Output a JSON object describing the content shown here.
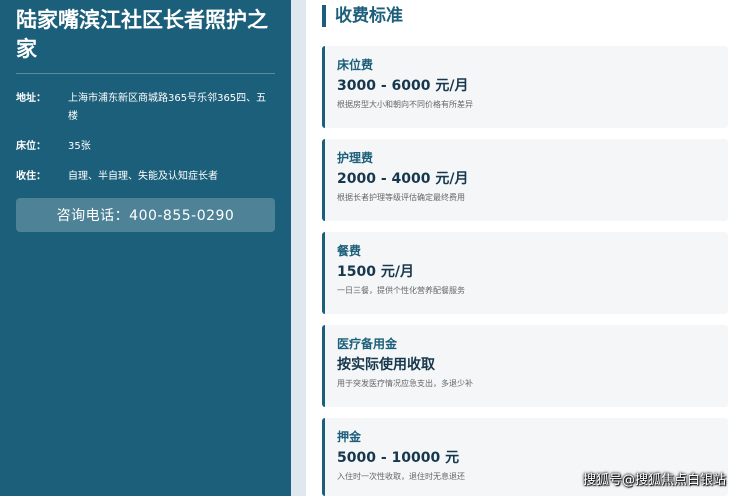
{
  "facility": {
    "name": "陆家嘴滨江社区长者照护之家",
    "address_label": "地址：",
    "address_value": "上海市浦东新区商城路365号乐邻365四、五楼",
    "beds_label": "床位：",
    "beds_value": "35张",
    "admission_label": "收住：",
    "admission_value": "自理、半自理、失能及认知症长者",
    "phone_button": "咨询电话：400-855-0290"
  },
  "pricing": {
    "heading": "收费标准",
    "items": [
      {
        "name": "床位费",
        "price": "3000 - 6000 元/月",
        "note": "根据房型大小和朝向不同价格有所差异"
      },
      {
        "name": "护理费",
        "price": "2000 - 4000 元/月",
        "note": "根据长者护理等级评估确定最终费用"
      },
      {
        "name": "餐费",
        "price": "1500 元/月",
        "note": "一日三餐，提供个性化营养配餐服务"
      },
      {
        "name": "医疗备用金",
        "price": "按实际使用收取",
        "note": "用于突发医疗情况应急支出，多退少补"
      },
      {
        "name": "押金",
        "price": "5000 - 10000 元",
        "note": "入住时一次性收取，退住时无息退还"
      }
    ]
  },
  "watermark": "搜狐号@搜狐焦点白银站",
  "colors": {
    "sidebar": "#1c5f7a",
    "accent": "#1c5f7a",
    "price": "#17374d"
  }
}
